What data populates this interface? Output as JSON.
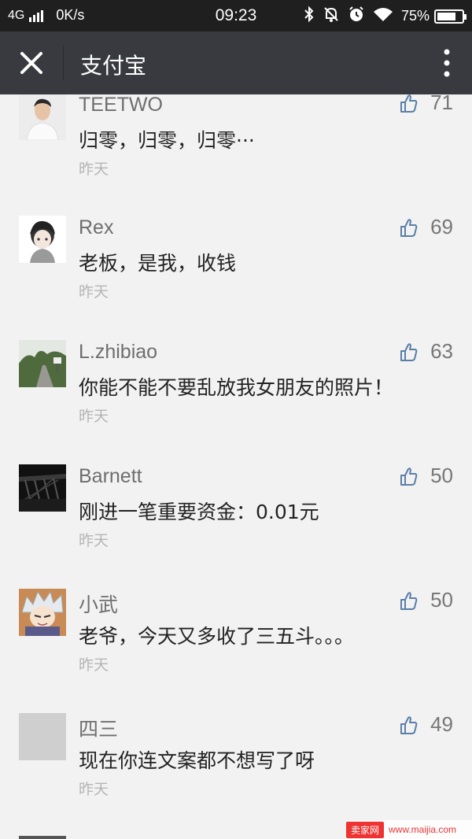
{
  "status_bar": {
    "network": "4G",
    "speed": "0K/s",
    "time": "09:23",
    "battery": "75%",
    "battery_level": 0.75,
    "icons": [
      "bluetooth-icon",
      "alarm-off-icon",
      "alarm-icon",
      "wifi-icon",
      "battery-icon"
    ]
  },
  "nav": {
    "close_icon": "close-icon",
    "title": "支付宝",
    "more_icon": "more-vertical-icon",
    "colors": {
      "background": "#393a3f",
      "status_bar": "#1f1f1f"
    }
  },
  "comments": [
    {
      "name": "TEETWO",
      "text": "归零，归零，归零···",
      "time": "昨天",
      "likes": "71",
      "avatar": "avatar-man-white-shirt"
    },
    {
      "name": "Rex",
      "text": "老板，是我，收钱",
      "time": "昨天",
      "likes": "69",
      "avatar": "avatar-anime-boy"
    },
    {
      "name": "L.zhibiao",
      "text": "你能不能不要乱放我女朋友的照片！",
      "time": "昨天",
      "likes": "63",
      "avatar": "avatar-road-landscape"
    },
    {
      "name": "Barnett",
      "text": "刚进一笔重要资金：0.01元",
      "time": "昨天",
      "likes": "50",
      "avatar": "avatar-dark-bridge"
    },
    {
      "name": "小武",
      "text": "老爷，今天又多收了三五斗。。。",
      "time": "昨天",
      "likes": "50",
      "avatar": "avatar-anime-silver-hair"
    },
    {
      "name": "四三",
      "text": "现在你连文案都不想写了呀",
      "time": "昨天",
      "likes": "49",
      "avatar": "avatar-placeholder-gray"
    }
  ],
  "watermark": {
    "logo": "卖家网",
    "url": "www.maijia.com"
  }
}
